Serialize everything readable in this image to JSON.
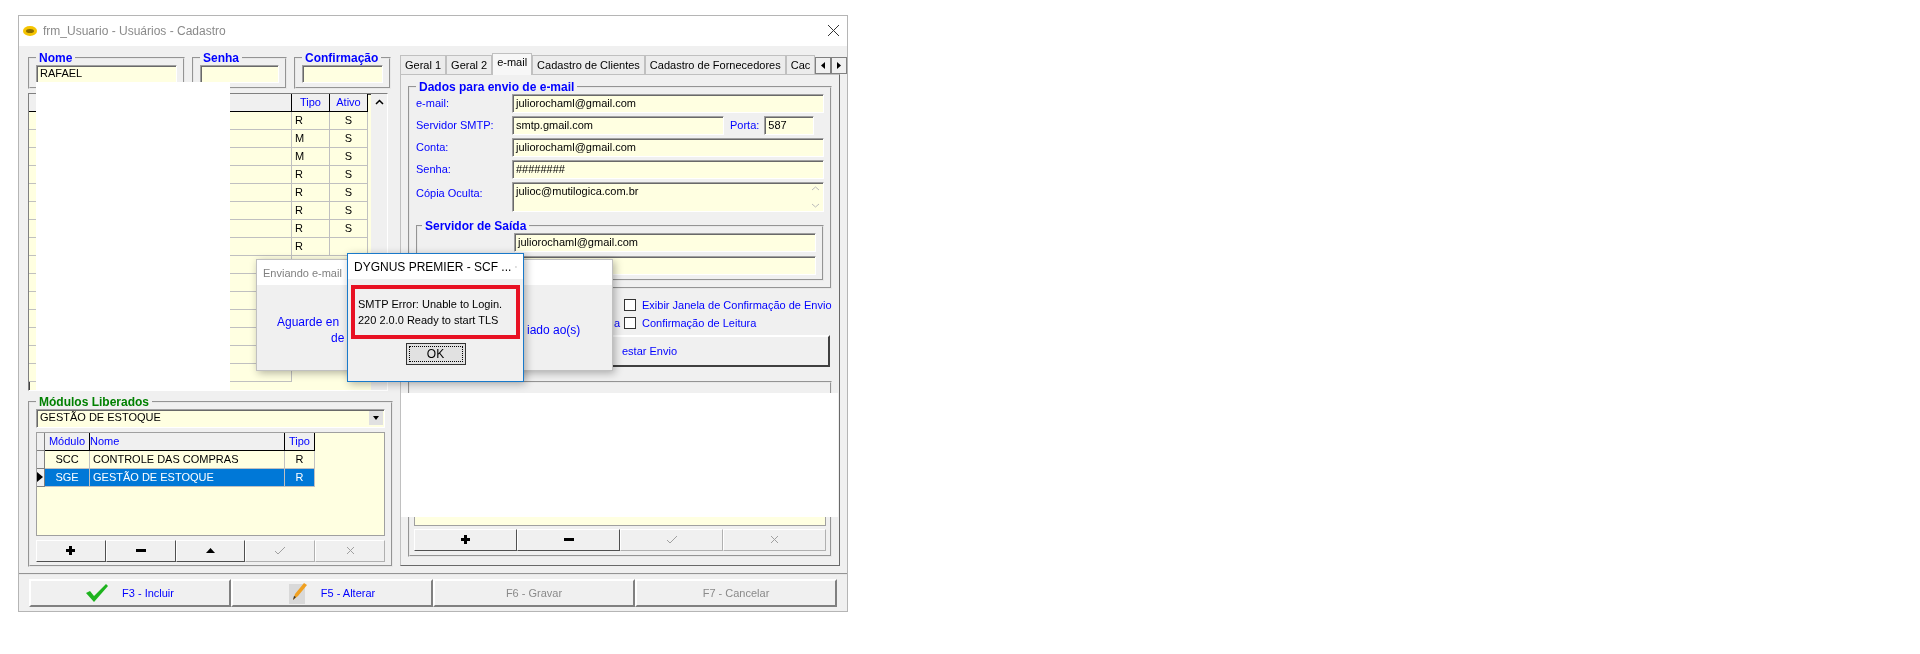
{
  "window": {
    "title": "frm_Usuario - Usuários - Cadastro"
  },
  "top_fields": [
    {
      "label": "Nome",
      "value": "RAFAEL"
    },
    {
      "label": "Senha"
    },
    {
      "label": "Confirmação"
    }
  ],
  "users_table": {
    "columns": [
      "Tipo",
      "Ativo"
    ],
    "rows": [
      {
        "tipo": "R",
        "ativo": "S"
      },
      {
        "tipo": "M",
        "ativo": "S"
      },
      {
        "tipo": "M",
        "ativo": "S"
      },
      {
        "tipo": "R",
        "ativo": "S"
      },
      {
        "tipo": "R",
        "ativo": "S"
      },
      {
        "tipo": "R",
        "ativo": "S"
      },
      {
        "tipo": "R",
        "ativo": "S"
      },
      {
        "tipo": "R"
      }
    ]
  },
  "modules": {
    "title": "Módulos Liberados",
    "combo": "GESTÃO DE ESTOQUE",
    "columns": [
      "Módulo",
      "Nome",
      "Tipo"
    ],
    "rows": [
      {
        "modulo": "SCC",
        "nome": "CONTROLE DAS COMPRAS",
        "tipo": "R",
        "selected": false
      },
      {
        "modulo": "SGE",
        "nome": "GESTÃO DE ESTOQUE",
        "tipo": "R",
        "selected": true
      }
    ],
    "buttons": [
      {
        "kind": "plus",
        "disabled": false
      },
      {
        "kind": "minus",
        "disabled": false
      },
      {
        "kind": "up",
        "disabled": false
      },
      {
        "kind": "check",
        "disabled": true
      },
      {
        "kind": "cancel",
        "disabled": true
      }
    ]
  },
  "tabs": [
    {
      "label": "Geral 1",
      "selected": false
    },
    {
      "label": "Geral 2",
      "selected": false
    },
    {
      "label": "e-mail",
      "selected": true
    },
    {
      "label": "Cadastro de Clientes",
      "selected": false
    },
    {
      "label": "Cadastro de Fornecedores",
      "selected": false
    },
    {
      "label": "Cac",
      "selected": false
    }
  ],
  "email_group": {
    "title": "Dados para envio de e-mail",
    "fields": [
      {
        "kind": "text",
        "label": "e-mail:",
        "value": "juliorochaml@gmail.com"
      },
      {
        "kind": "port",
        "label": "Servidor SMTP:",
        "value": "smtp.gmail.com",
        "port_label": "Porta:",
        "port": "587"
      },
      {
        "kind": "text",
        "label": "Conta:",
        "value": "juliorochaml@gmail.com"
      },
      {
        "kind": "text",
        "label": "Senha:",
        "value": "########"
      },
      {
        "kind": "memo",
        "label": "Cópia Oculta:",
        "value": "julioc@mutilogica.com.br"
      }
    ]
  },
  "outgoing": {
    "title": "Servidor de Saída",
    "fields": [
      {
        "kind": "text",
        "value": "juliorochaml@gmail.com"
      },
      {
        "kind": "text"
      }
    ]
  },
  "options": {
    "fragment": "a",
    "checkboxes": [
      {
        "label": "Exibir Janela de Confirmação de Envio",
        "checked": false
      },
      {
        "label": "Confirmação de Leitura",
        "checked": false
      }
    ]
  },
  "test_button": "estar Envio",
  "right_buttons": [
    {
      "kind": "plus",
      "disabled": false
    },
    {
      "kind": "minus",
      "disabled": false
    },
    {
      "kind": "check",
      "disabled": true
    },
    {
      "kind": "cancel",
      "disabled": true
    }
  ],
  "footer": [
    {
      "label": "F3 - Incluir",
      "kind": "check",
      "disabled": false
    },
    {
      "label": "F5 - Alterar",
      "kind": "pencil",
      "disabled": false
    },
    {
      "label": "F6 - Gravar",
      "kind": "plain",
      "disabled": true
    },
    {
      "label": "F7 - Cancelar",
      "kind": "plain",
      "disabled": true
    }
  ],
  "sending_dialog": {
    "title": "Enviando e-mail",
    "text_left": [
      "Aguarde en",
      "de"
    ],
    "text_right": "iado ao(s)"
  },
  "error_dialog": {
    "title": "DYGNUS PREMIER - SCF ...",
    "message": [
      "SMTP Error: Unable to Login.",
      "220 2.0.0 Ready to start TLS"
    ],
    "button": "OK"
  }
}
